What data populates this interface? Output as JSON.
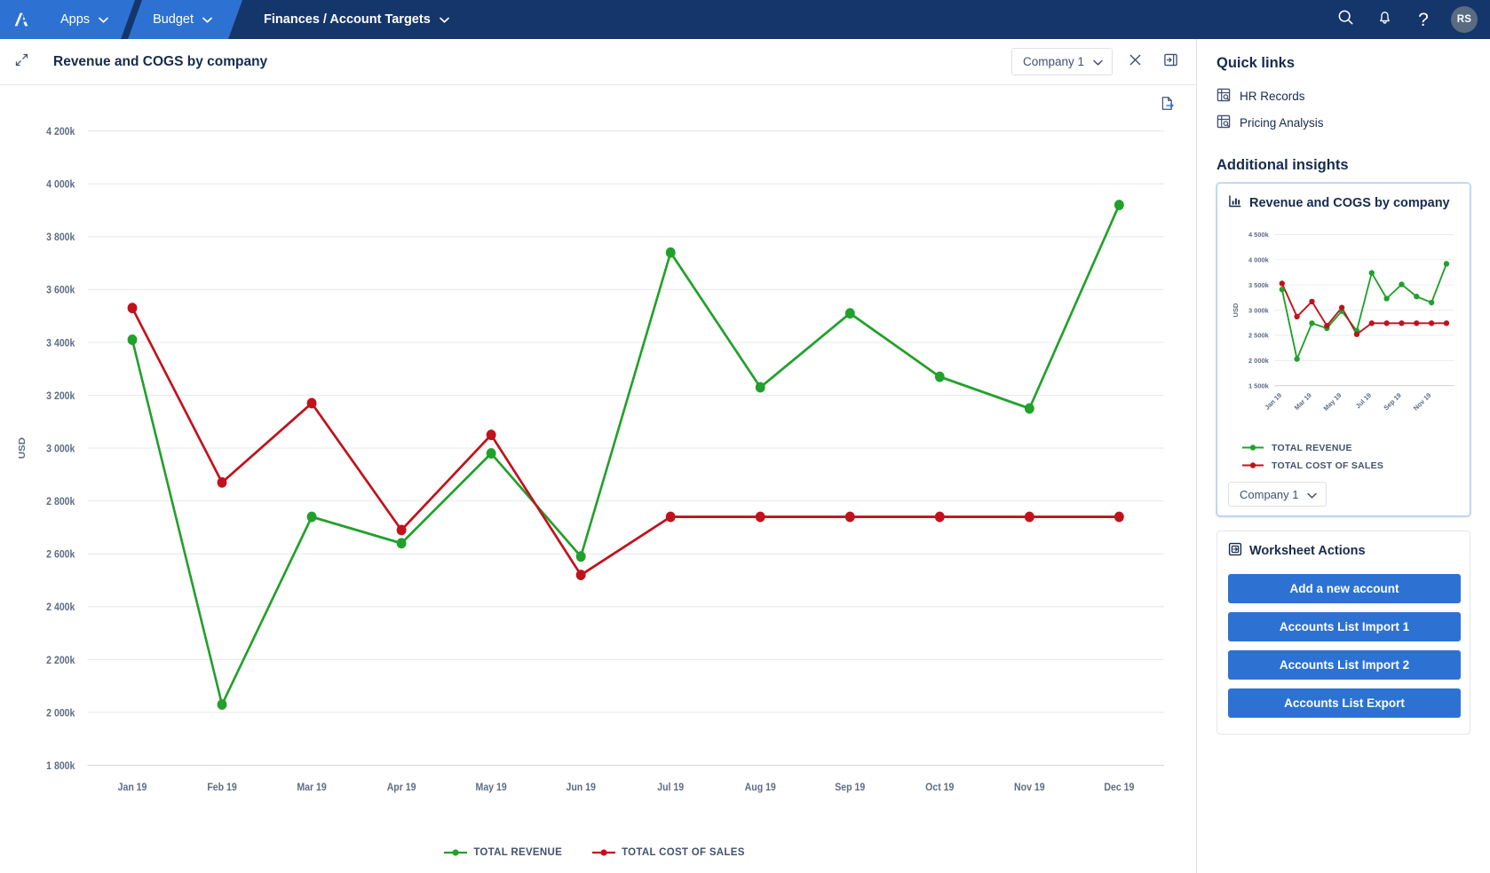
{
  "topnav": {
    "logo": "anaplan-logo",
    "apps_label": "Apps",
    "budget_label": "Budget",
    "breadcrumb_label": "Finances / Account Targets",
    "search_icon": "search-icon",
    "bell_icon": "bell-icon",
    "help_label": "?",
    "avatar_initials": "RS"
  },
  "card": {
    "title": "Revenue and COGS by company",
    "company_selector": "Company 1",
    "close_icon": "close-icon",
    "expand_icon": "expand-panel-icon",
    "collapse_icon": "collapse-icon",
    "export_icon": "export-document-icon"
  },
  "legend": {
    "revenue": "TOTAL REVENUE",
    "cost": "TOTAL COST OF SALES"
  },
  "colors": {
    "revenue": "#22a02c",
    "cost": "#c1121c",
    "accent": "#2d72d2",
    "nav_dark": "#15366b",
    "text": "#172b4d"
  },
  "sidebar": {
    "quick_links_title": "Quick links",
    "quick_links": [
      {
        "label": "HR Records",
        "icon": "grid-search-icon"
      },
      {
        "label": "Pricing Analysis",
        "icon": "grid-search-icon"
      }
    ],
    "additional_insights_title": "Additional insights",
    "insight_card": {
      "title": "Revenue and COGS by company",
      "icon": "bar-chart-icon",
      "company_selector": "Company 1"
    },
    "worksheet_actions": {
      "title": "Worksheet Actions",
      "icon": "worksheet-icon",
      "buttons": [
        "Add a new account",
        "Accounts List Import 1",
        "Accounts List Import 2",
        "Accounts List Export"
      ]
    }
  },
  "chart_data": {
    "type": "line",
    "title": "Revenue and COGS by company",
    "xlabel": "",
    "ylabel": "USD",
    "ylim": [
      1800000,
      4200000
    ],
    "ytick_labels": [
      "1 800k",
      "2 000k",
      "2 200k",
      "2 400k",
      "2 600k",
      "2 800k",
      "3 000k",
      "3 200k",
      "3 400k",
      "3 600k",
      "3 800k",
      "4 000k",
      "4 200k"
    ],
    "ytick_values": [
      1800000,
      2000000,
      2200000,
      2400000,
      2600000,
      2800000,
      3000000,
      3200000,
      3400000,
      3600000,
      3800000,
      4000000,
      4200000
    ],
    "categories": [
      "Jan 19",
      "Feb 19",
      "Mar 19",
      "Apr 19",
      "May 19",
      "Jun 19",
      "Jul 19",
      "Aug 19",
      "Sep 19",
      "Oct 19",
      "Nov 19",
      "Dec 19"
    ],
    "grid": true,
    "legend_position": "bottom",
    "series": [
      {
        "name": "TOTAL REVENUE",
        "color": "#22a02c",
        "values": [
          3410000,
          2030000,
          2740000,
          2640000,
          2980000,
          2590000,
          3740000,
          3230000,
          3510000,
          3270000,
          3150000,
          3920000
        ]
      },
      {
        "name": "TOTAL COST OF SALES",
        "color": "#c1121c",
        "values": [
          3530000,
          2870000,
          3170000,
          2690000,
          3050000,
          2520000,
          2740000,
          2740000,
          2740000,
          2740000,
          2740000,
          2740000
        ]
      }
    ]
  },
  "mini_chart_data": {
    "type": "line",
    "title": "Revenue and COGS by company",
    "ylabel": "USD",
    "ylim": [
      1500000,
      4500000
    ],
    "ytick_labels": [
      "1 500k",
      "2 000k",
      "2 500k",
      "3 000k",
      "3 500k",
      "4 000k",
      "4 500k"
    ],
    "ytick_values": [
      1500000,
      2000000,
      2500000,
      3000000,
      3500000,
      4000000,
      4500000
    ],
    "categories": [
      "Jan 19",
      "Feb 19",
      "Mar 19",
      "Apr 19",
      "May 19",
      "Jun 19",
      "Jul 19",
      "Aug 19",
      "Sep 19",
      "Oct 19",
      "Nov 19",
      "Dec 19"
    ],
    "xtick_labels": [
      "Jan 19",
      "Mar 19",
      "May 19",
      "Jul 19",
      "Sep 19",
      "Nov 19"
    ],
    "grid": true,
    "series": [
      {
        "name": "TOTAL REVENUE",
        "color": "#22a02c",
        "values": [
          3410000,
          2030000,
          2740000,
          2640000,
          2980000,
          2590000,
          3740000,
          3230000,
          3510000,
          3270000,
          3150000,
          3920000
        ]
      },
      {
        "name": "TOTAL COST OF SALES",
        "color": "#c1121c",
        "values": [
          3530000,
          2870000,
          3170000,
          2690000,
          3050000,
          2520000,
          2740000,
          2740000,
          2740000,
          2740000,
          2740000,
          2740000
        ]
      }
    ]
  }
}
